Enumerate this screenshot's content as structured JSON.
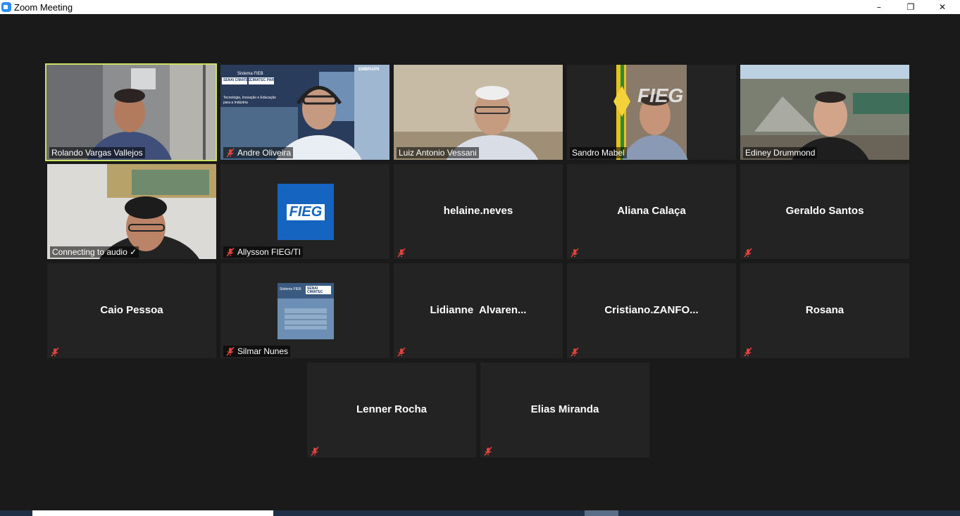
{
  "window": {
    "title": "Zoom Meeting",
    "minimize": "–",
    "restore": "❐",
    "close": "✕"
  },
  "participants": {
    "row1": [
      {
        "name": "Rolando Vargas Vallejos",
        "video": true,
        "muted": false,
        "active": true
      },
      {
        "name": "Andre Oliveira",
        "video": true,
        "muted": true
      },
      {
        "name": "Luiz Antonio Vessani",
        "video": true,
        "muted": false
      },
      {
        "name": "Sandro Mabel",
        "video": true,
        "muted": false
      },
      {
        "name": "Ediney Drummond",
        "video": true,
        "muted": false
      }
    ],
    "row2": [
      {
        "name": "Connecting to audio ✓",
        "video": true,
        "muted": false
      },
      {
        "name": "Allysson FIEG/TI",
        "video": false,
        "muted": true,
        "avatar_text": "FIEG"
      },
      {
        "name": "helaine.neves",
        "video": false,
        "muted": true
      },
      {
        "name": "Aliana Calaça",
        "video": false,
        "muted": true
      },
      {
        "name": "Geraldo Santos",
        "video": false,
        "muted": true
      }
    ],
    "row3": [
      {
        "name": "Caio Pessoa",
        "video": false,
        "muted": true
      },
      {
        "name": "Silmar Nunes",
        "video": false,
        "muted": true
      },
      {
        "name": "Lidianne  Alvaren...",
        "video": false,
        "muted": true
      },
      {
        "name": "Cristiano.ZANFO...",
        "video": false,
        "muted": true
      },
      {
        "name": "Rosana",
        "video": false,
        "muted": true
      }
    ],
    "row4": [
      {
        "name": "Lenner Rocha",
        "video": false,
        "muted": true
      },
      {
        "name": "Elias Miranda",
        "video": false,
        "muted": true
      }
    ]
  },
  "backgrounds": {
    "andre_sign_1": "Sistema FIEB",
    "andre_sign_2": "SENAI CIMATEC",
    "andre_sign_3": "CIMATEC PARK",
    "andre_sign_4": "Tecnologia, Inovação e Educação para a Indústria",
    "andre_sign_5": "EMBRAPII",
    "sandro_sign": "FIEG",
    "silmar_sign_1": "Sistema FIEB",
    "silmar_sign_2": "SENAI CIMATEC"
  },
  "colors": {
    "active_speaker": "#c9e265",
    "tile_bg": "#232323",
    "stage_bg": "#1a1a1a",
    "mute_red": "#e0433f",
    "fieg_blue": "#1565c0"
  }
}
